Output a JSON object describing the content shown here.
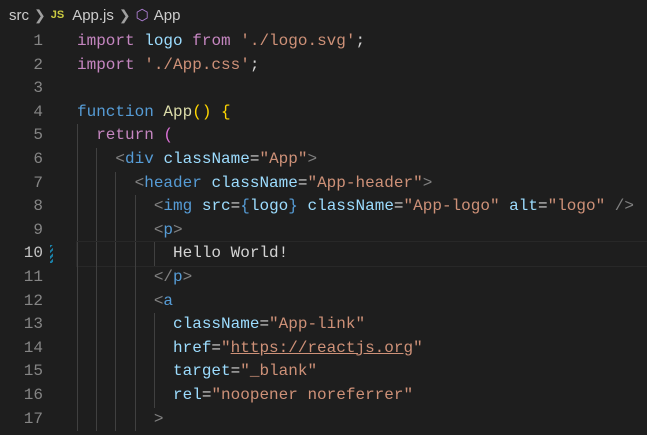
{
  "breadcrumb": {
    "folder": "src",
    "file_icon": "JS",
    "file": "App.js",
    "symbol_icon": "cube-icon",
    "symbol": "App"
  },
  "current_line": 10,
  "lines": [
    {
      "n": "1",
      "tokens": [
        [
          "import",
          "kw"
        ],
        [
          " ",
          "tx"
        ],
        [
          "logo",
          "vr"
        ],
        [
          " ",
          "tx"
        ],
        [
          "from",
          "kw"
        ],
        [
          " ",
          "tx"
        ],
        [
          "'./logo.svg'",
          "st"
        ],
        [
          ";",
          "tx"
        ]
      ]
    },
    {
      "n": "2",
      "tokens": [
        [
          "import",
          "kw"
        ],
        [
          " ",
          "tx"
        ],
        [
          "'./App.css'",
          "st"
        ],
        [
          ";",
          "tx"
        ]
      ]
    },
    {
      "n": "3",
      "tokens": []
    },
    {
      "n": "4",
      "tokens": [
        [
          "function",
          "bl"
        ],
        [
          " ",
          "tx"
        ],
        [
          "App",
          "fn"
        ],
        [
          "()",
          "br"
        ],
        [
          " ",
          "tx"
        ],
        [
          "{",
          "br"
        ]
      ]
    },
    {
      "n": "5",
      "tokens": [
        [
          "  ",
          "tx"
        ],
        [
          "return",
          "kw"
        ],
        [
          " ",
          "tx"
        ],
        [
          "(",
          "pp"
        ]
      ]
    },
    {
      "n": "6",
      "tokens": [
        [
          "    ",
          "tx"
        ],
        [
          "<",
          "gr"
        ],
        [
          "div",
          "bl"
        ],
        [
          " ",
          "tx"
        ],
        [
          "className",
          "vr"
        ],
        [
          "=",
          "tx"
        ],
        [
          "\"App\"",
          "st"
        ],
        [
          ">",
          "gr"
        ]
      ]
    },
    {
      "n": "7",
      "tokens": [
        [
          "      ",
          "tx"
        ],
        [
          "<",
          "gr"
        ],
        [
          "header",
          "bl"
        ],
        [
          " ",
          "tx"
        ],
        [
          "className",
          "vr"
        ],
        [
          "=",
          "tx"
        ],
        [
          "\"App-header\"",
          "st"
        ],
        [
          ">",
          "gr"
        ]
      ]
    },
    {
      "n": "8",
      "tokens": [
        [
          "        ",
          "tx"
        ],
        [
          "<",
          "gr"
        ],
        [
          "img",
          "bl"
        ],
        [
          " ",
          "tx"
        ],
        [
          "src",
          "vr"
        ],
        [
          "=",
          "tx"
        ],
        [
          "{",
          "bl"
        ],
        [
          "logo",
          "vr"
        ],
        [
          "}",
          "bl"
        ],
        [
          " ",
          "tx"
        ],
        [
          "className",
          "vr"
        ],
        [
          "=",
          "tx"
        ],
        [
          "\"App-logo\"",
          "st"
        ],
        [
          " ",
          "tx"
        ],
        [
          "alt",
          "vr"
        ],
        [
          "=",
          "tx"
        ],
        [
          "\"logo\"",
          "st"
        ],
        [
          " ",
          "tx"
        ],
        [
          "/>",
          "gr"
        ]
      ]
    },
    {
      "n": "9",
      "tokens": [
        [
          "        ",
          "tx"
        ],
        [
          "<",
          "gr"
        ],
        [
          "p",
          "bl"
        ],
        [
          ">",
          "gr"
        ]
      ]
    },
    {
      "n": "10",
      "tokens": [
        [
          "          ",
          "tx"
        ],
        [
          "Hello World!",
          "tx"
        ]
      ]
    },
    {
      "n": "11",
      "tokens": [
        [
          "        ",
          "tx"
        ],
        [
          "</",
          "gr"
        ],
        [
          "p",
          "bl"
        ],
        [
          ">",
          "gr"
        ]
      ]
    },
    {
      "n": "12",
      "tokens": [
        [
          "        ",
          "tx"
        ],
        [
          "<",
          "gr"
        ],
        [
          "a",
          "bl"
        ]
      ]
    },
    {
      "n": "13",
      "tokens": [
        [
          "          ",
          "tx"
        ],
        [
          "className",
          "vr"
        ],
        [
          "=",
          "tx"
        ],
        [
          "\"App-link\"",
          "st"
        ]
      ]
    },
    {
      "n": "14",
      "tokens": [
        [
          "          ",
          "tx"
        ],
        [
          "href",
          "vr"
        ],
        [
          "=",
          "tx"
        ],
        [
          "\"",
          "st"
        ],
        [
          "https://reactjs.org",
          "ul"
        ],
        [
          "\"",
          "st"
        ]
      ]
    },
    {
      "n": "15",
      "tokens": [
        [
          "          ",
          "tx"
        ],
        [
          "target",
          "vr"
        ],
        [
          "=",
          "tx"
        ],
        [
          "\"_blank\"",
          "st"
        ]
      ]
    },
    {
      "n": "16",
      "tokens": [
        [
          "          ",
          "tx"
        ],
        [
          "rel",
          "vr"
        ],
        [
          "=",
          "tx"
        ],
        [
          "\"noopener noreferrer\"",
          "st"
        ]
      ]
    },
    {
      "n": "17",
      "tokens": [
        [
          "        ",
          "tx"
        ],
        [
          ">",
          "gr"
        ]
      ]
    }
  ]
}
